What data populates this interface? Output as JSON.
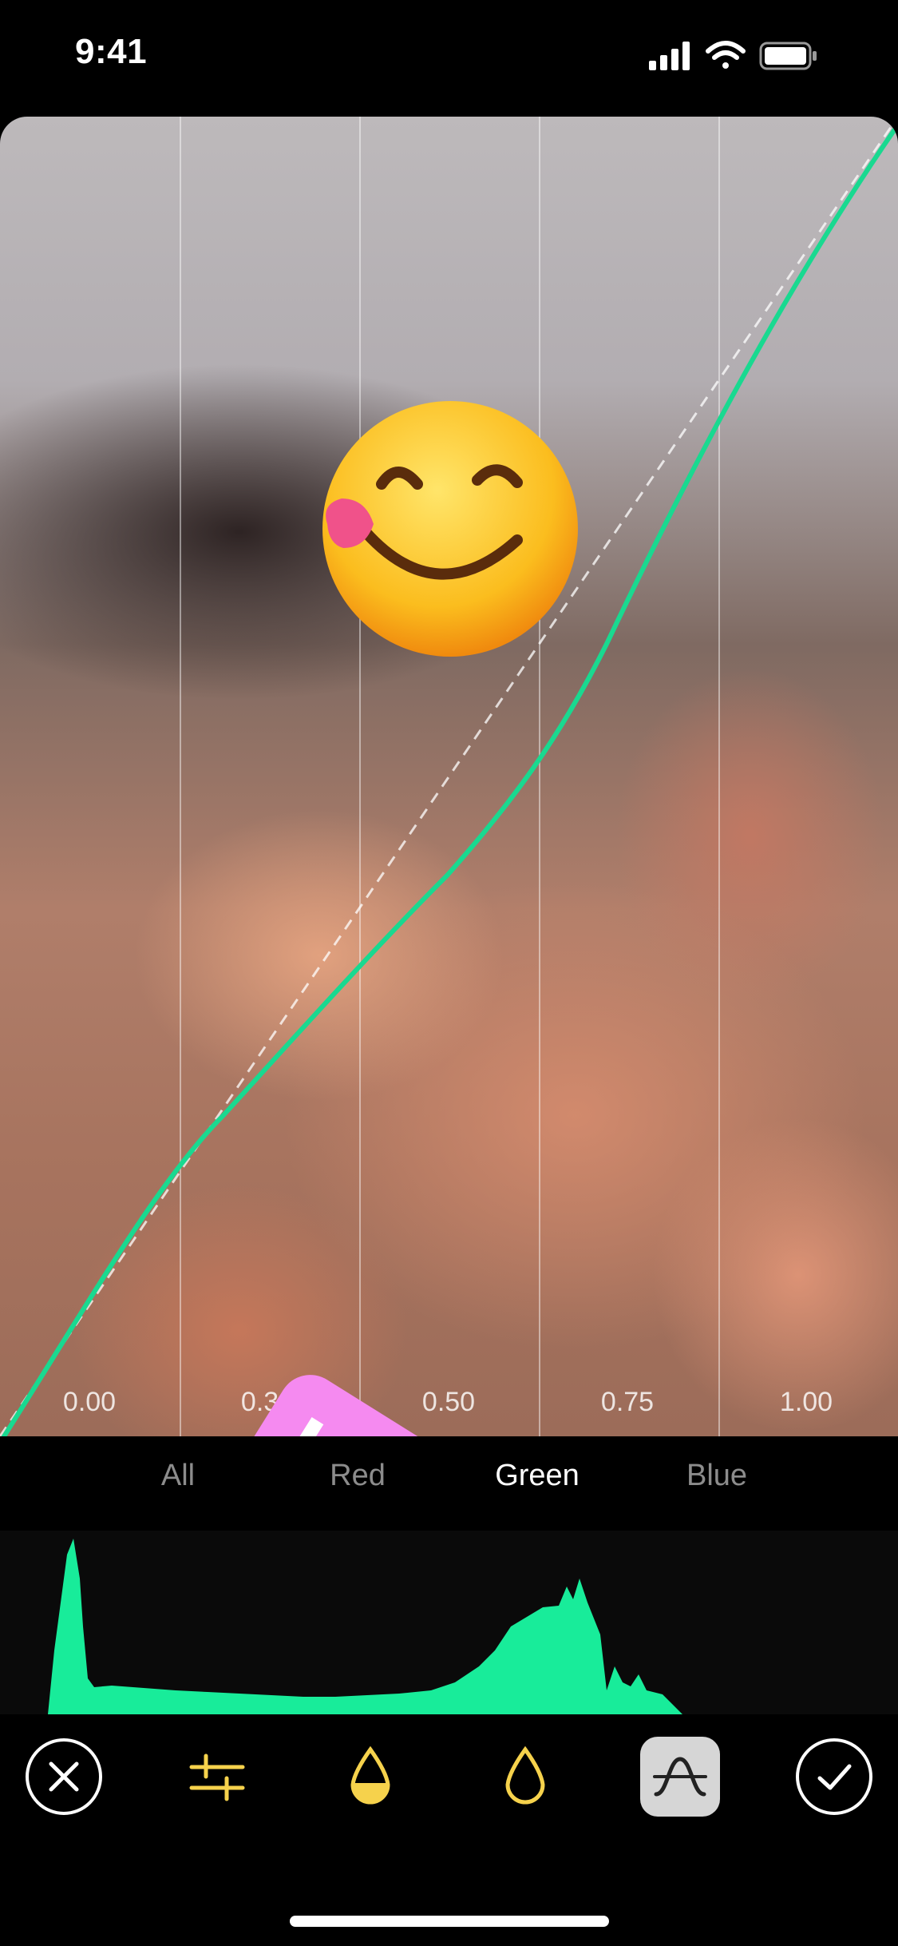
{
  "status_bar": {
    "time": "9:41"
  },
  "curve": {
    "tick_labels": [
      "0.00",
      "0.31",
      "0.50",
      "0.75",
      "1.00"
    ],
    "curve_color": "#19d990"
  },
  "sticker": {
    "text": "I hope we will, too",
    "color": "#f58af0"
  },
  "channels": [
    "All",
    "Red",
    "Green",
    "Blue"
  ],
  "selected_channel": "Green",
  "histogram": {
    "color": "#18ec9a"
  },
  "toolbar": {
    "items": [
      "cancel-icon",
      "sliders-icon",
      "half-drop-icon",
      "drop-icon",
      "curves-icon",
      "confirm-icon"
    ],
    "selected": "curves-icon",
    "accent": "#f6d24c"
  }
}
